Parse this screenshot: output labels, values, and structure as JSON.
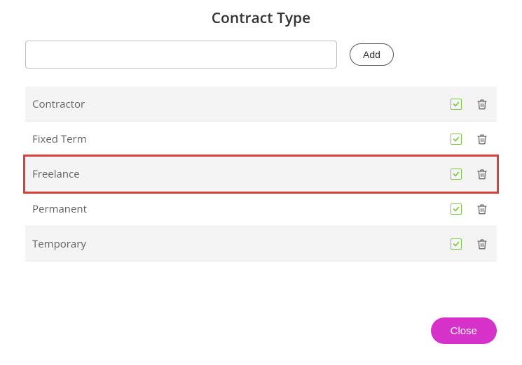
{
  "title": "Contract Type",
  "add": {
    "input_value": "",
    "input_placeholder": "",
    "button_label": "Add"
  },
  "items": [
    {
      "label": "Contractor",
      "checked": true,
      "shaded": true,
      "highlighted": false
    },
    {
      "label": "Fixed Term",
      "checked": true,
      "shaded": false,
      "highlighted": false
    },
    {
      "label": "Freelance",
      "checked": true,
      "shaded": true,
      "highlighted": true
    },
    {
      "label": "Permanent",
      "checked": true,
      "shaded": false,
      "highlighted": false
    },
    {
      "label": "Temporary",
      "checked": true,
      "shaded": true,
      "highlighted": false
    }
  ],
  "close_label": "Close",
  "colors": {
    "accent_check": "#7ac943",
    "highlight_border": "#d9423a",
    "close_button": "#d631c9"
  }
}
